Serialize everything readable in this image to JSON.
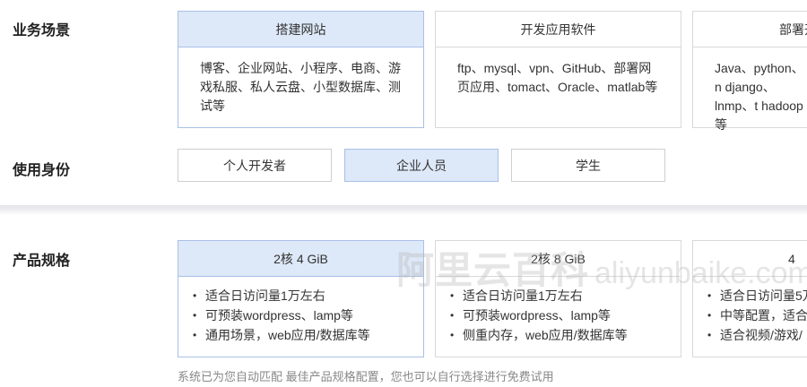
{
  "scenario": {
    "label": "业务场景",
    "cards": [
      {
        "title": "搭建网站",
        "desc": "博客、企业网站、小程序、电商、游戏私服、私人云盘、小型数据库、测试等"
      },
      {
        "title": "开发应用软件",
        "desc": "ftp、mysql、vpn、GitHub、部署网页应用、tomact、Oracle、matlab等"
      },
      {
        "title": "部署开",
        "desc": "Java、python、n django、lnmp、t hadoop等"
      }
    ]
  },
  "identity": {
    "label": "使用身份",
    "options": [
      "个人开发者",
      "企业人员",
      "学生"
    ]
  },
  "spec": {
    "label": "产品规格",
    "cards": [
      {
        "title": "2核 4 GiB",
        "features": [
          "适合日访问量1万左右",
          "可预装wordpress、lamp等",
          "通用场景，web应用/数据库等"
        ]
      },
      {
        "title": "2核 8 GiB",
        "features": [
          "适合日访问量1万左右",
          "可预装wordpress、lamp等",
          "侧重内存，web应用/数据库等"
        ]
      },
      {
        "title": "4",
        "features": [
          "适合日访问量5万",
          "中等配置，适合",
          "适合视频/游戏/"
        ]
      }
    ],
    "hint": "系统已为您自动匹配 最佳产品规格配置，您也可以自行选择进行免费试用"
  },
  "watermark": {
    "cn": "阿里云百科",
    "latin": "aliyunbaike.com"
  },
  "colors": {
    "selected_bg": "#dde8f8",
    "selected_border": "#a9c0e6",
    "border": "#d9d9d9"
  }
}
